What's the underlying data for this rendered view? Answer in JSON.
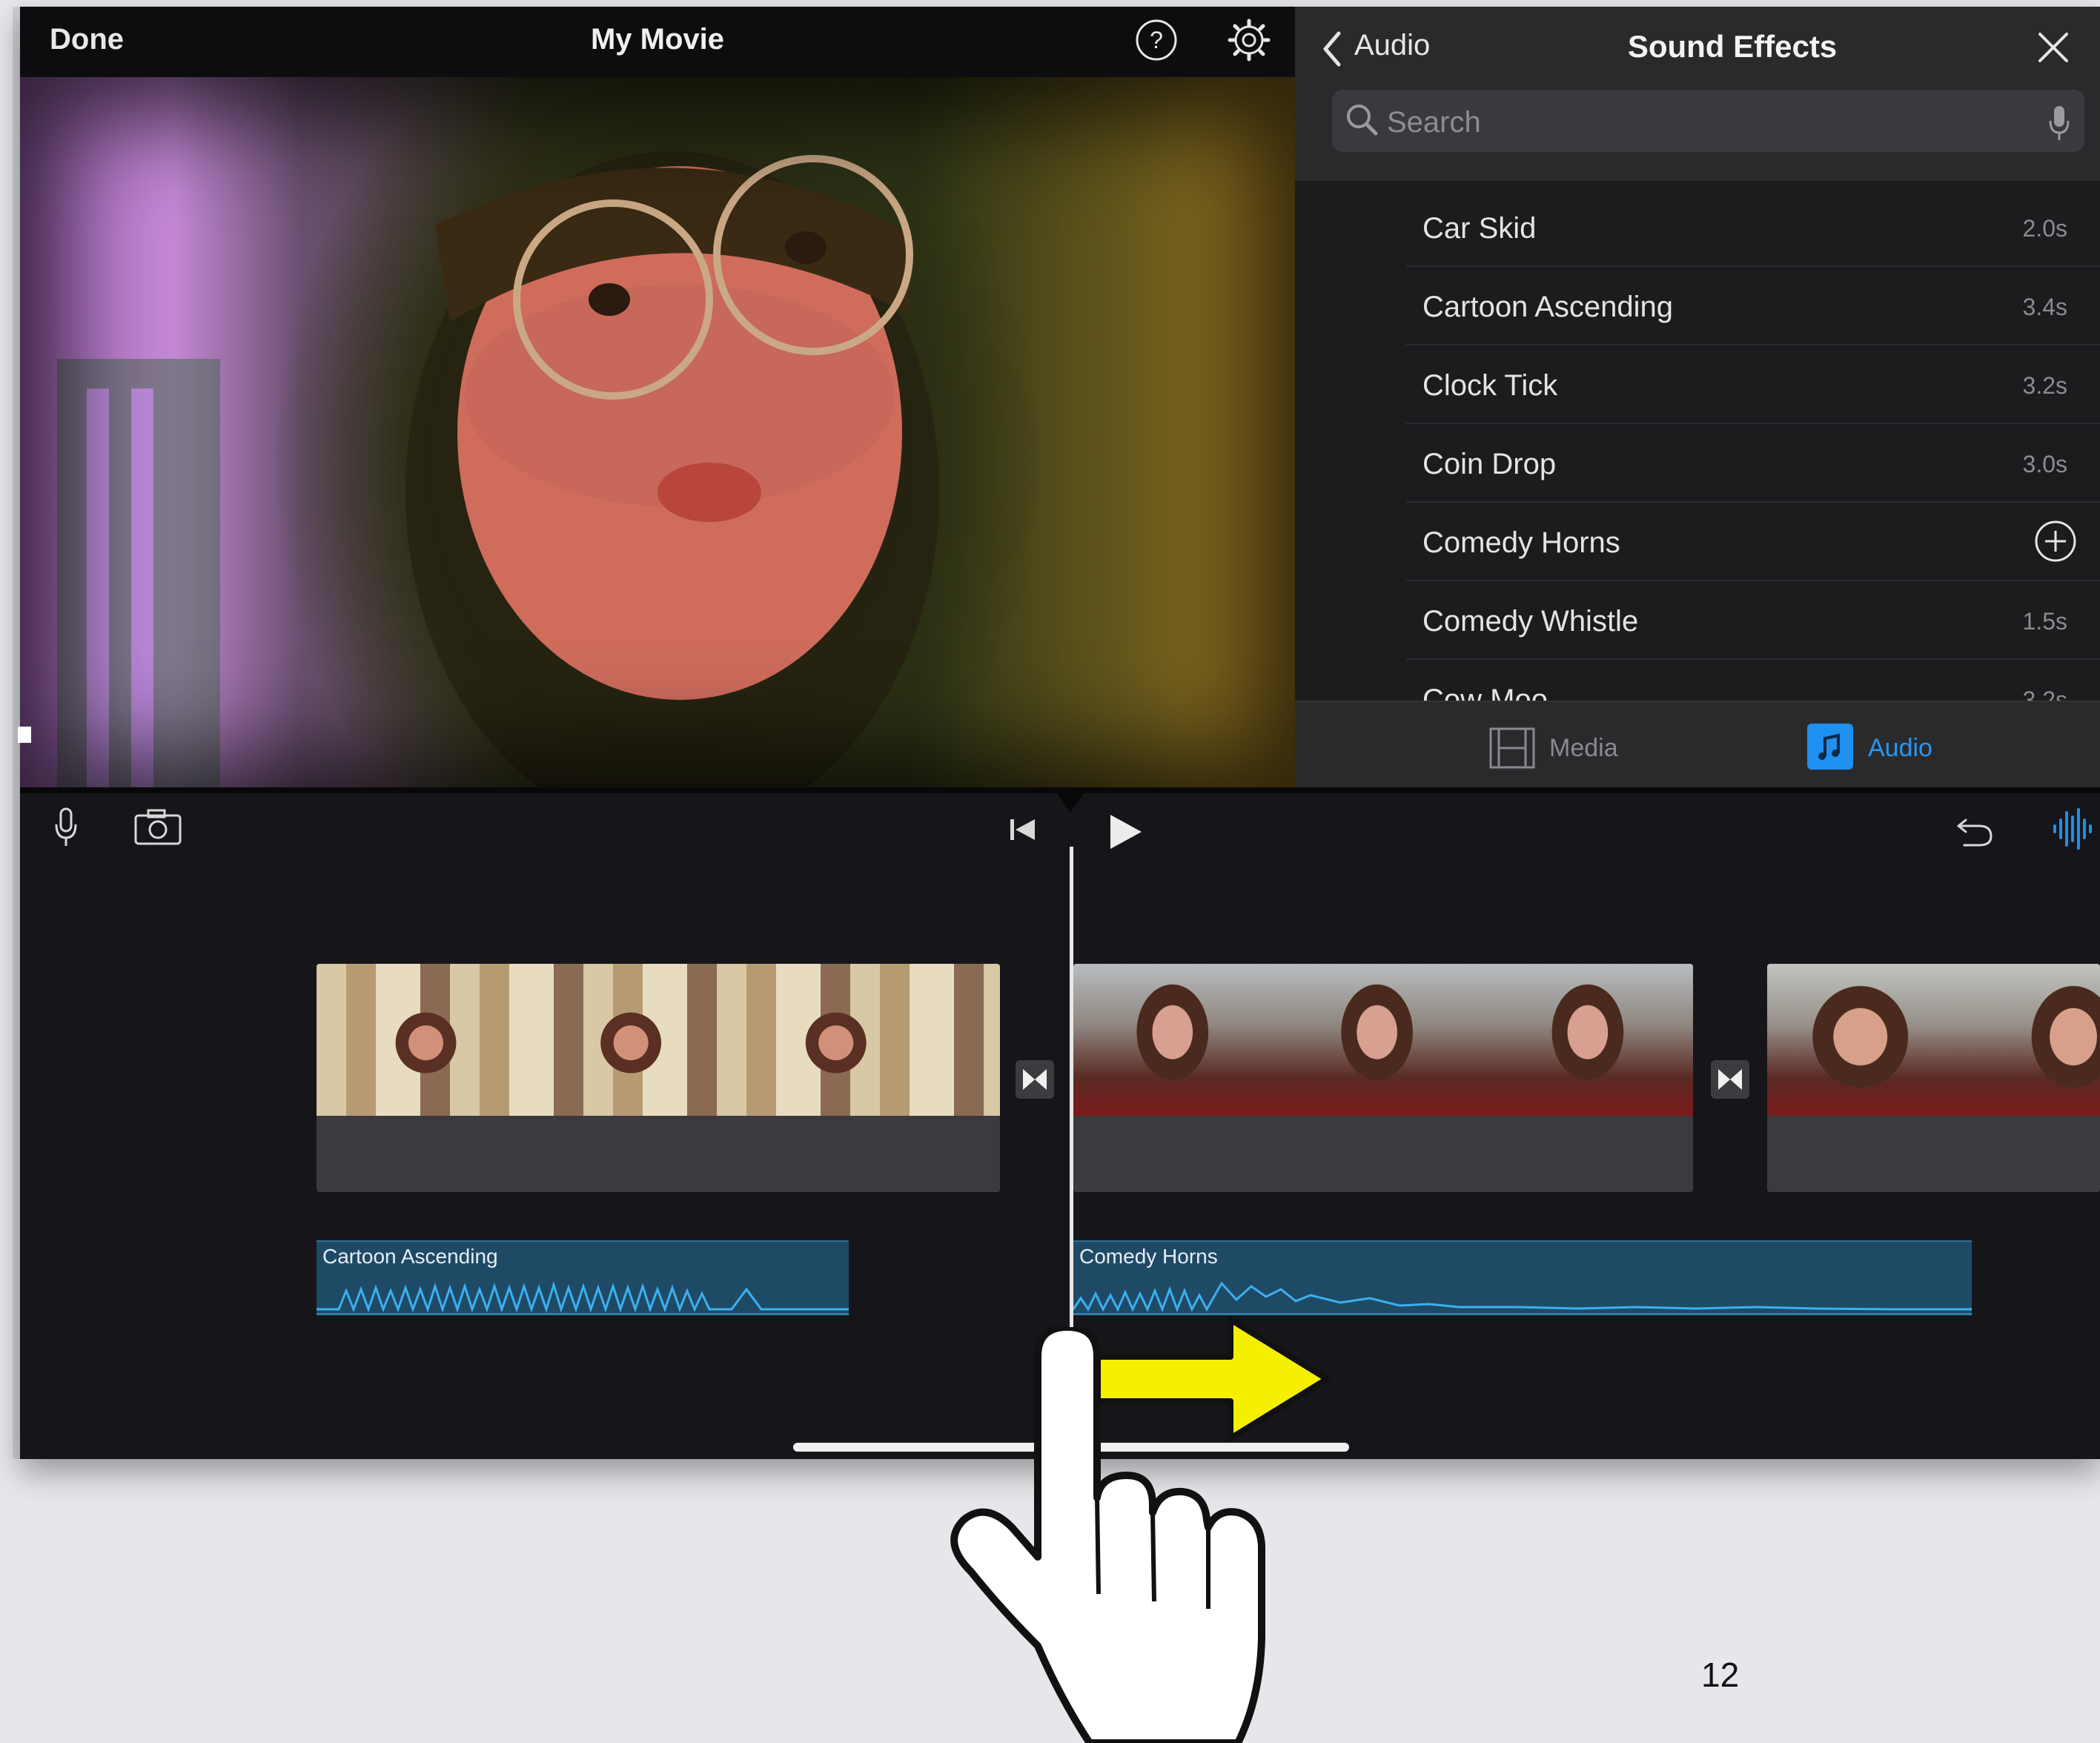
{
  "topbar": {
    "done_label": "Done",
    "title": "My Movie",
    "help_icon": "help-icon",
    "settings_icon": "gear-icon"
  },
  "panel": {
    "back_label": "Audio",
    "title": "Sound Effects",
    "search_placeholder": "Search",
    "items": [
      {
        "name": "Car Skid",
        "duration": "2.0s"
      },
      {
        "name": "Cartoon Ascending",
        "duration": "3.4s"
      },
      {
        "name": "Clock Tick",
        "duration": "3.2s"
      },
      {
        "name": "Coin Drop",
        "duration": "3.0s"
      },
      {
        "name": "Comedy Horns",
        "duration": ""
      },
      {
        "name": "Comedy Whistle",
        "duration": "1.5s"
      },
      {
        "name": "Cow Moo",
        "duration": "3.2s"
      }
    ],
    "tabs": {
      "media": "Media",
      "audio": "Audio",
      "selected": "Audio"
    }
  },
  "timeline": {
    "audio_clips": [
      {
        "label": "Cartoon Ascending"
      },
      {
        "label": "Comedy Horns"
      }
    ]
  },
  "page_number": "12",
  "colors": {
    "accent": "#2a96f2",
    "audio_clip": "#1f4a66",
    "arrow": "#f5f000"
  }
}
